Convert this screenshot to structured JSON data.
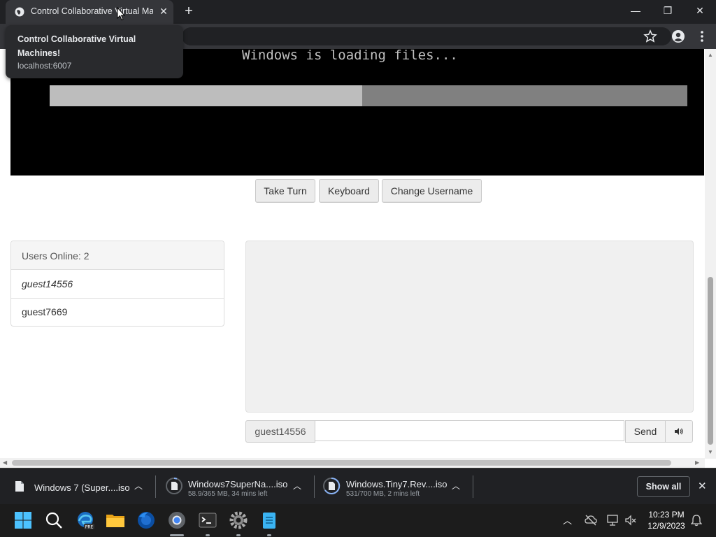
{
  "browser": {
    "tab_title": "Control Collaborative Virtual Machines!",
    "tooltip": {
      "title": "Control Collaborative Virtual Machines!",
      "url": "localhost:6007"
    }
  },
  "vm": {
    "screen_text": "Windows is loading files...",
    "progress": 0.49
  },
  "controls": {
    "take_turn": "Take Turn",
    "keyboard": "Keyboard",
    "change_username": "Change Username"
  },
  "users": {
    "header": "Users Online: 2",
    "list": [
      {
        "name": "guest14556"
      },
      {
        "name": "guest7669"
      }
    ]
  },
  "chat": {
    "username": "guest14556",
    "input_value": "",
    "send_label": "Send"
  },
  "downloads": {
    "items": [
      {
        "name": "Windows 7 (Super....iso",
        "status": ""
      },
      {
        "name": "Windows7SuperNa....iso",
        "status": "58.9/365 MB, 34 mins left"
      },
      {
        "name": "Windows.Tiny7.Rev....iso",
        "status": "531/700 MB, 2 mins left"
      }
    ],
    "show_all": "Show all"
  },
  "taskbar": {
    "time": "10:23 PM",
    "date": "12/9/2023",
    "apps": [
      "start-icon",
      "search-icon",
      "edge-dev-icon",
      "file-explorer-icon",
      "firefox-icon",
      "chrome-icon",
      "terminal-icon",
      "settings-icon",
      "notepad-icon"
    ]
  },
  "colors": {
    "chrome_dark": "#202124",
    "vm_bar_fill": "#bdbdbd",
    "vm_bar_track": "#808080"
  }
}
